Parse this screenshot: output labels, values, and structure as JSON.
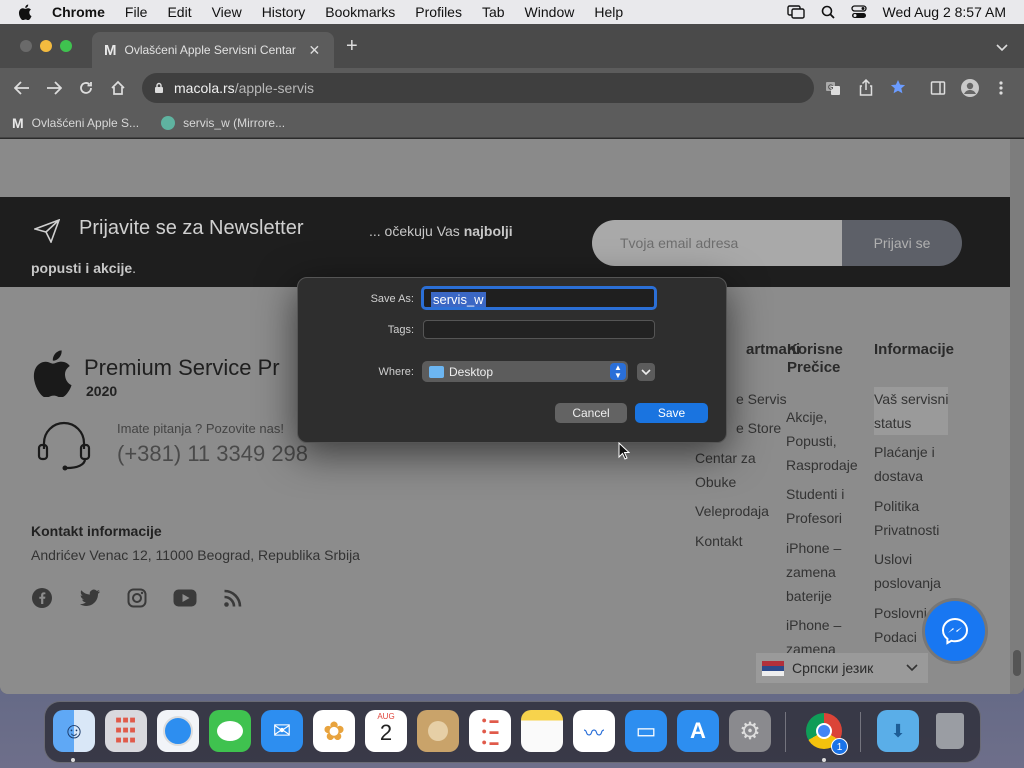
{
  "menubar": {
    "app": "Chrome",
    "items": [
      "File",
      "Edit",
      "View",
      "History",
      "Bookmarks",
      "Profiles",
      "Tab",
      "Window",
      "Help"
    ],
    "datetime": "Wed Aug 2  8:57 AM"
  },
  "browser": {
    "tab_title": "Ovlašćeni Apple Servisni Centar",
    "url_host": "macola.rs",
    "url_path": "/apple-servis",
    "bookmarks": [
      "Ovlašćeni Apple S...",
      "servis_w (Mirrore..."
    ]
  },
  "page": {
    "newsletter_title": "Prijavite se za Newsletter",
    "newsletter_text_pre": "... očekuju Vas ",
    "newsletter_text_bold1": "najbolji",
    "newsletter_text_bold2": "popusti i akcije",
    "newsletter_text_post": ".",
    "email_placeholder": "Tvoja email adresa",
    "subscribe_label": "Prijavi se",
    "brand_title": "Premium Service Pr",
    "brand_year": "2020",
    "contact_question": "Imate pitanja ? Pozovite nas!",
    "phone": "(+381) 11 3349 298",
    "contact_heading": "Kontakt informacije",
    "address": "Andrićev Venac 12, 11000 Beograd, Republika Srbija",
    "social_icons": [
      "facebook-icon",
      "twitter-icon",
      "instagram-icon",
      "youtube-icon",
      "rss-icon"
    ],
    "col1_title": "artmani",
    "col1_items": [
      "e Servis",
      "e Store",
      "Centar za\nObuke",
      "Veleprodaja",
      "Kontakt"
    ],
    "col2_title": "Korisne\nPrečice",
    "col2_items": [
      "Akcije,\nPopusti,\nRasprodaje",
      "Studenti i\nProfesori",
      "iPhone –\nzamena\nbaterije",
      "iPhone –\nzamena"
    ],
    "col3_title": "Informacije",
    "col3_items": [
      "Vaš servisni\nstatus",
      "Plaćanje i\ndostava",
      "Politika\nPrivatnosti",
      "Uslovi\nposlovanja",
      "Poslovni\nPodaci"
    ],
    "language_label": "Српски језик"
  },
  "dialog": {
    "save_as_label": "Save As:",
    "save_as_value": "servis_w",
    "tags_label": "Tags:",
    "tags_value": "",
    "where_label": "Where:",
    "where_value": "Desktop",
    "cancel_label": "Cancel",
    "save_label": "Save"
  },
  "dock": {
    "apps": [
      "Finder",
      "Launchpad",
      "Safari",
      "Messages",
      "Mail",
      "Photos",
      "Calendar",
      "Contacts",
      "Reminders",
      "Notes",
      "Freeform",
      "Keynote",
      "App Store",
      "System Settings",
      "Google Chrome",
      "Downloads",
      "Trash"
    ],
    "calendar_month": "AUG",
    "calendar_day": "2",
    "chrome_badge": "1"
  },
  "colors": {
    "accent": "#0a66d9",
    "messenger": "#1877f2"
  }
}
